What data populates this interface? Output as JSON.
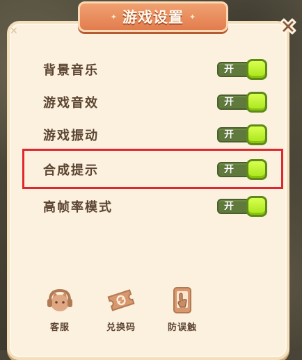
{
  "dialog": {
    "title": "游戏设置"
  },
  "settings": [
    {
      "label": "背景音乐",
      "state": "开",
      "on": true
    },
    {
      "label": "游戏音效",
      "state": "开",
      "on": true
    },
    {
      "label": "游戏振动",
      "state": "开",
      "on": true
    },
    {
      "label": "合成提示",
      "state": "开",
      "on": true
    },
    {
      "label": "高帧率模式",
      "state": "开",
      "on": true
    }
  ],
  "bottom_buttons": [
    {
      "label": "客服",
      "icon": "customer-service-icon"
    },
    {
      "label": "兑换码",
      "icon": "redeem-ticket-icon"
    },
    {
      "label": "防误触",
      "icon": "anti-mistouch-icon"
    }
  ],
  "colors": {
    "panel_bg": "#fbf1de",
    "title_ribbon": "#e27d4e",
    "label_text": "#5b4431",
    "toggle_track": "#5f7a3c",
    "toggle_knob": "#b8ef2a",
    "highlight": "#e0262e"
  }
}
